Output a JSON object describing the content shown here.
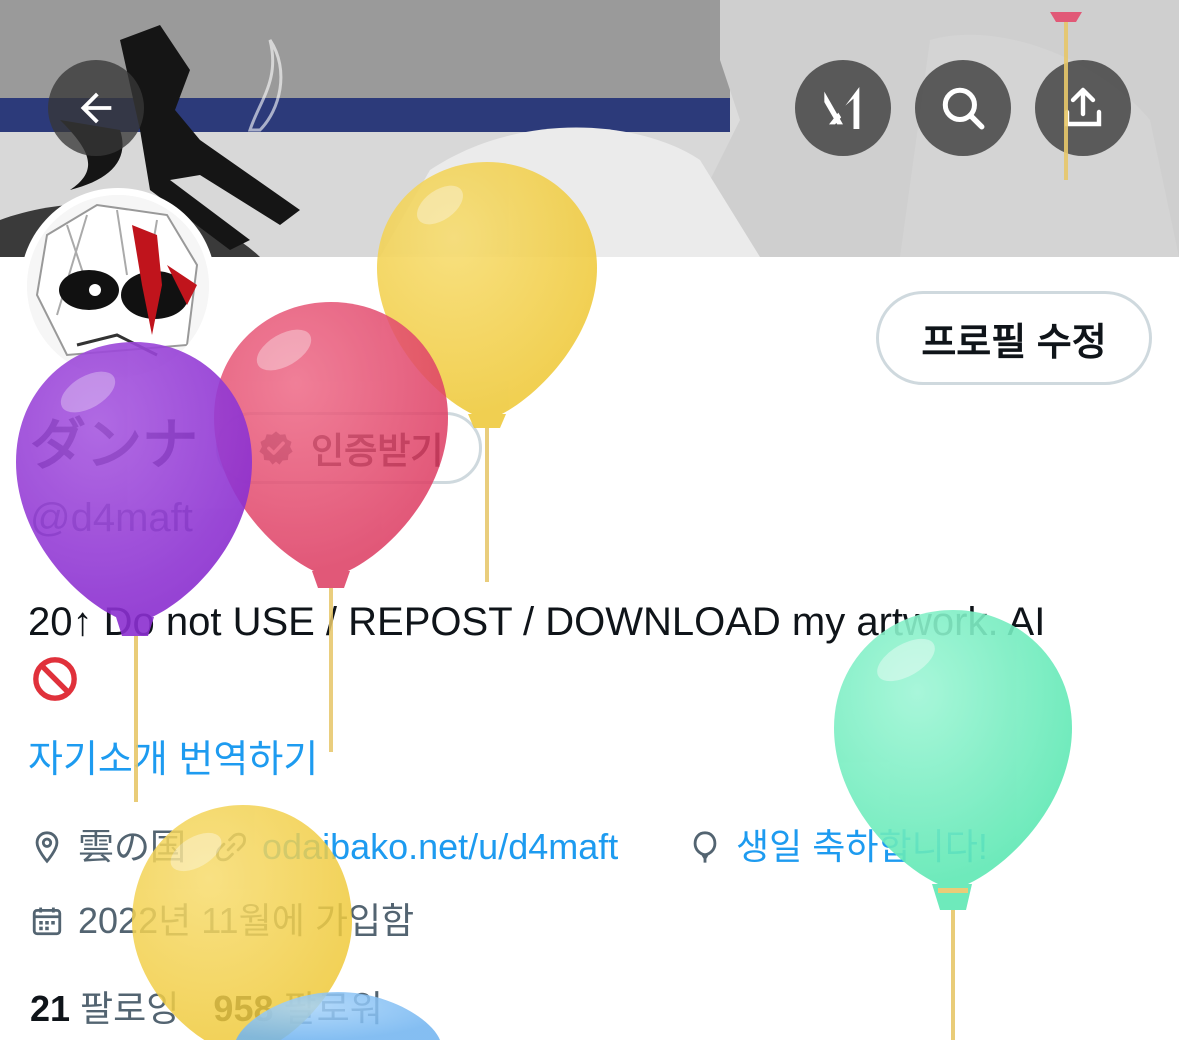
{
  "header": {
    "back_icon": "arrow-left-icon",
    "grok_icon": "grok-icon",
    "search_icon": "search-icon",
    "share_icon": "share-icon"
  },
  "profile": {
    "edit_label": "프로필 수정",
    "display_name": "ダンナ",
    "verify_label": "인증받기",
    "handle": "@d4maft",
    "bio": "20↑ Do not USE / REPOST / DOWNLOAD my artwork. AI",
    "bio_emoji": "no-entry-sign-icon",
    "translate_label": "자기소개 번역하기",
    "location": "雲の国",
    "website": "odaibako.net/u/d4maft",
    "birthday": "생일 축하합니다!",
    "joined": "2022년 11월에 가입함",
    "following_count": "21",
    "following_label": "팔로잉",
    "followers_count": "958",
    "followers_label": "팔로워"
  },
  "colors": {
    "link_blue": "#1d9bf0",
    "balloon_purple": "#9b3fd6",
    "balloon_red": "#e44d6e",
    "balloon_yellow": "#f2cf4a",
    "balloon_green": "#7ef0c2",
    "balloon_blue": "#8ac4f5"
  }
}
